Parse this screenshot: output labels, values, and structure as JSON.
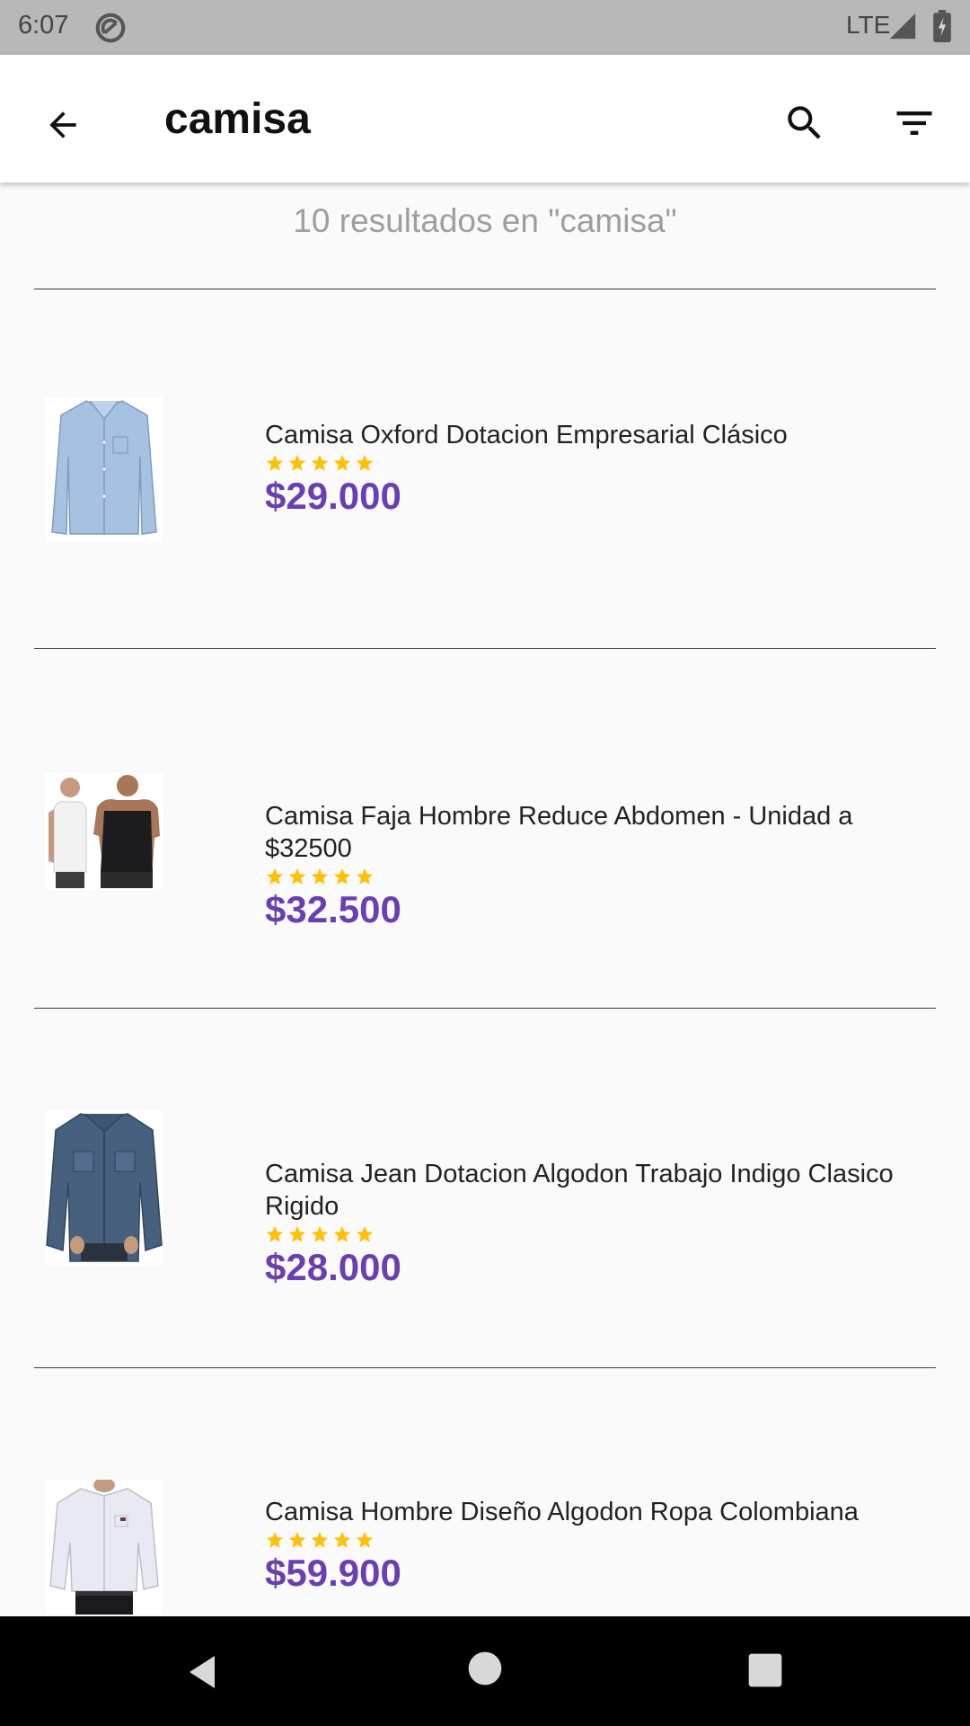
{
  "status_bar": {
    "time": "6:07",
    "network": "LTE",
    "icons": [
      "sync-icon",
      "signal-icon",
      "battery-charging-icon"
    ]
  },
  "app_bar": {
    "back_icon": "arrow-back-icon",
    "title": "camisa",
    "search_icon": "search-icon",
    "filter_icon": "filter-icon"
  },
  "results": {
    "summary": "10 resultados en \"camisa\""
  },
  "colors": {
    "price": "#6a3fb1",
    "star": "#ffc107",
    "divider": "#3a3a3a",
    "status_bar_bg": "#b8b8b8",
    "nav_bar_bg": "#000000"
  },
  "products": [
    {
      "name": "Camisa Oxford Dotacion Empresarial Clásico",
      "rating": 5,
      "price": "$29.000",
      "image": "light-blue-oxford-shirt"
    },
    {
      "name": "Camisa Faja Hombre Reduce Abdomen - Unidad a $32500",
      "rating": 5,
      "price": "$32.500",
      "image": "compression-shirts-white-black"
    },
    {
      "name": "Camisa Jean Dotacion Algodon Trabajo Indigo Clasico Rigido",
      "rating": 5,
      "price": "$28.000",
      "image": "denim-jean-shirt"
    },
    {
      "name": "Camisa Hombre Diseño Algodon Ropa Colombiana",
      "rating": 5,
      "price": "$59.900",
      "image": "white-men-shirt"
    }
  ],
  "nav_bar": {
    "icons": [
      "nav-back-icon",
      "nav-home-icon",
      "nav-recents-icon"
    ]
  }
}
